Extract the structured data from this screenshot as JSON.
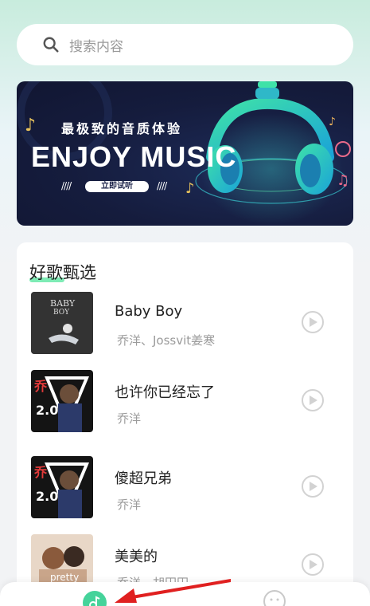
{
  "search": {
    "placeholder": "搜索内容"
  },
  "banner": {
    "subtitle": "最极致的音质体验",
    "title": "ENJOY MUSIC",
    "button_label": "立即试听"
  },
  "section": {
    "title": "好歌甄选"
  },
  "songs": [
    {
      "title": "Baby Boy",
      "artist": "乔洋、Jossvit姜寒",
      "cover_label": "BABY BOY"
    },
    {
      "title": "也许你已经忘了",
      "artist": "乔洋",
      "cover_label": "乔洋 2.0"
    },
    {
      "title": "傻超兄弟",
      "artist": "乔洋",
      "cover_label": "乔洋 2.0"
    },
    {
      "title": "美美的",
      "artist": "乔洋、胡円円",
      "cover_label": "pretty"
    }
  ],
  "colors": {
    "accent": "#45d39a",
    "banner_bg": "#151c3d"
  },
  "bottom_nav": {
    "items": [
      "music-note-icon",
      "face-icon"
    ]
  }
}
